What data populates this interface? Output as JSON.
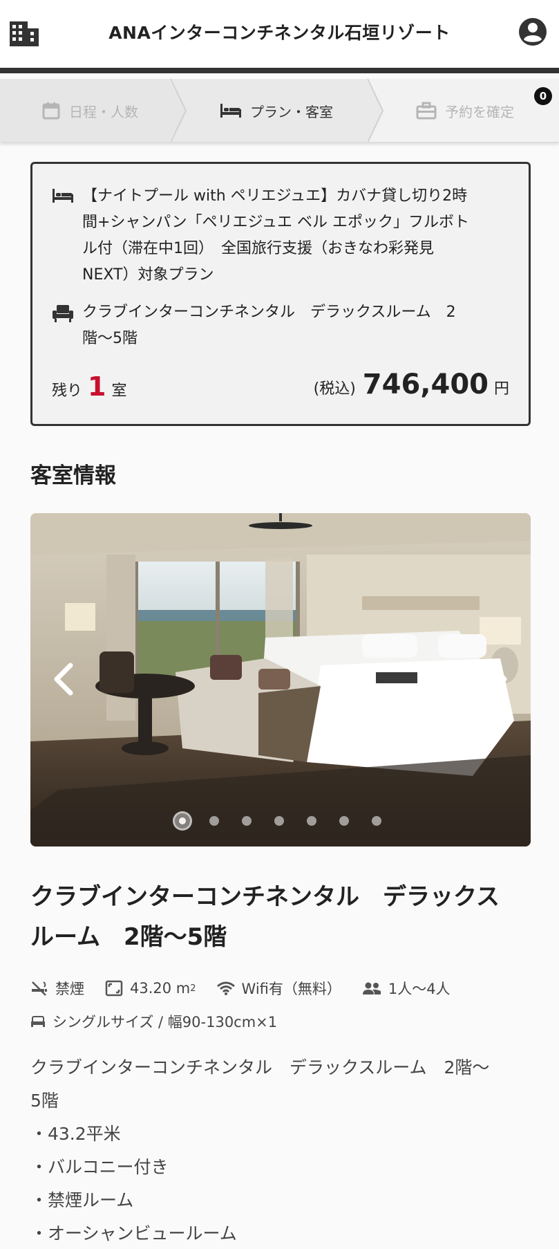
{
  "header": {
    "title": "ANAインターコンチネンタル石垣リゾート",
    "menu_icon": "building-icon",
    "account_icon": "account-circle-icon"
  },
  "steps": [
    {
      "label": "日程・人数",
      "icon": "calendar-icon",
      "state": "done"
    },
    {
      "label": "プラン・客室",
      "icon": "bed-icon",
      "state": "active"
    },
    {
      "label": "予約を確定",
      "icon": "briefcase-icon",
      "state": "pending"
    }
  ],
  "cart_badge": "0",
  "plan_card": {
    "plan_name": "【ナイトプール with ペリエジュエ】カバナ貸し切り2時間+シャンパン「ペリエジュエ ベル エポック」フルボトル付（滞在中1回）　全国旅行支援（おきなわ彩発見NEXT）対象プラン",
    "plan_line1": "【ナイトプール with ペリエジュエ】カバナ貸し切り2時",
    "plan_line2": "間+シャンパン「ペリエジュエ ベル エポック」フルボト",
    "plan_line3": "ル付（滞在中1回）　全国旅行支援（おきなわ彩発見",
    "plan_line4": "NEXT）対象プラン",
    "room_line1": "クラブインターコンチネンタル　デラックスルーム　2",
    "room_line2": "階〜5階",
    "remaining_prefix": "残り",
    "remaining_count": "1",
    "remaining_suffix": "室",
    "tax_label": "(税込)",
    "price": "746,400",
    "currency": "円"
  },
  "section_title": "客室情報",
  "carousel": {
    "dot_count": 7,
    "active_index": 0
  },
  "room": {
    "title_line1": "クラブインターコンチネンタル　デラックス",
    "title_line2": "ルーム　2階〜5階",
    "smoking": "禁煙",
    "area": "43.20 m",
    "area_sup": "2",
    "wifi": "Wifi有（無料）",
    "capacity": "1人〜4人",
    "bed": "シングルサイズ / 幅90-130cm×1",
    "desc_line1": "クラブインターコンチネンタル　デラックスルーム　2階〜",
    "desc_line2": "5階",
    "desc_line3": "・43.2平米",
    "desc_line4": "・バルコニー付き",
    "desc_line5": "・禁煙ルーム",
    "desc_line6": "・オーシャンビュールーム"
  },
  "colors": {
    "accent_red": "#c8102e",
    "dark": "#333333"
  }
}
